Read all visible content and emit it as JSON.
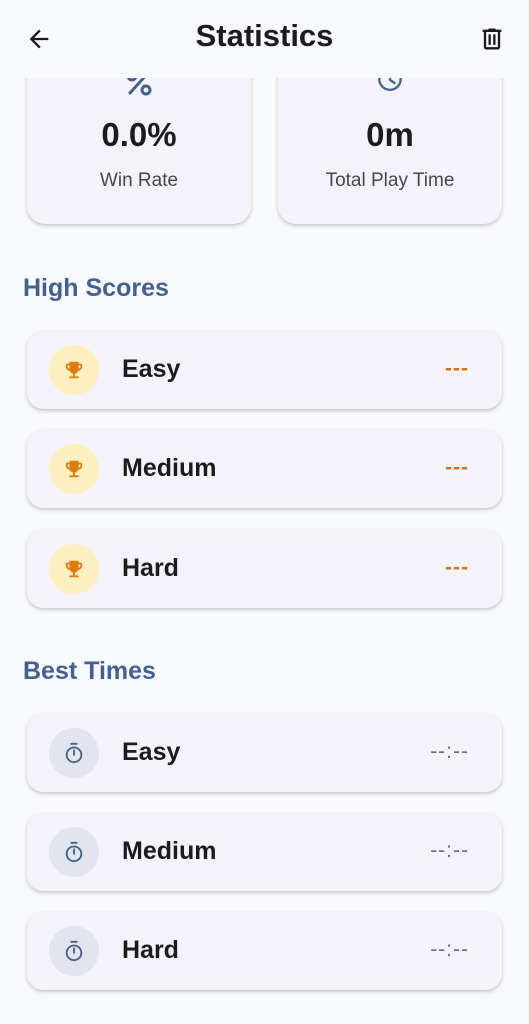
{
  "appbar": {
    "title": "Statistics",
    "back_icon": "arrow-back-icon",
    "delete_icon": "trash-icon"
  },
  "summary": {
    "win_rate": {
      "value": "0.0%",
      "label": "Win Rate",
      "icon": "percent-icon"
    },
    "play_time": {
      "value": "0m",
      "label": "Total Play Time",
      "icon": "clock-icon"
    }
  },
  "high_scores": {
    "title": "High Scores",
    "items": [
      {
        "label": "Easy",
        "value": "---",
        "icon": "trophy-icon"
      },
      {
        "label": "Medium",
        "value": "---",
        "icon": "trophy-icon"
      },
      {
        "label": "Hard",
        "value": "---",
        "icon": "trophy-icon"
      }
    ]
  },
  "best_times": {
    "title": "Best Times",
    "items": [
      {
        "label": "Easy",
        "value": "--:--",
        "icon": "timer-icon"
      },
      {
        "label": "Medium",
        "value": "--:--",
        "icon": "timer-icon"
      },
      {
        "label": "Hard",
        "value": "--:--",
        "icon": "timer-icon"
      }
    ]
  },
  "colors": {
    "accent": "#45608e",
    "trophy": "#e07b12",
    "score_placeholder": "#d9731a",
    "background": "#f8f9fc"
  }
}
